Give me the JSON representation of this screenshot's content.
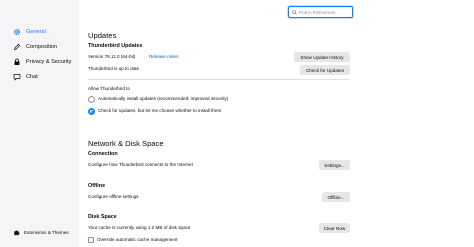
{
  "sidebar": {
    "items": [
      {
        "label": "General",
        "icon": "gear-icon",
        "active": true
      },
      {
        "label": "Composition",
        "icon": "pencil-icon",
        "active": false
      },
      {
        "label": "Privacy & Security",
        "icon": "lock-icon",
        "active": false
      },
      {
        "label": "Chat",
        "icon": "chat-icon",
        "active": false
      }
    ],
    "footer_link": "Extensions & Themes"
  },
  "search": {
    "placeholder": "Find in Preferences"
  },
  "updates": {
    "heading": "Updates",
    "subheading": "Thunderbird Updates",
    "version": "Version 78.11.0 (64-bit)",
    "release_notes": "Release notes",
    "status": "Thunderbird is up to date",
    "show_history_button": "Show Update History",
    "check_button": "Check for Updates",
    "allow_label": "Allow Thunderbird to",
    "options": [
      {
        "label": "Automatically install updates (recommended: improved security)",
        "checked": false
      },
      {
        "label": "Check for updates, but let me choose whether to install them",
        "checked": true
      }
    ]
  },
  "network": {
    "heading": "Network & Disk Space",
    "connection": {
      "title": "Connection",
      "desc": "Configure how Thunderbird connects to the Internet",
      "button": "Settings..."
    },
    "offline": {
      "title": "Offline",
      "desc": "Configure offline settings",
      "button": "Offline..."
    },
    "disk": {
      "title": "Disk Space",
      "desc": "Your cache is currently using 1.2 MB of disk space",
      "button": "Clear Now",
      "override_label": "Override automatic cache management"
    }
  },
  "colors": {
    "accent": "#0a84ff",
    "sidebar_bg": "#f5f5f7",
    "button_bg": "#e6e6e8"
  }
}
